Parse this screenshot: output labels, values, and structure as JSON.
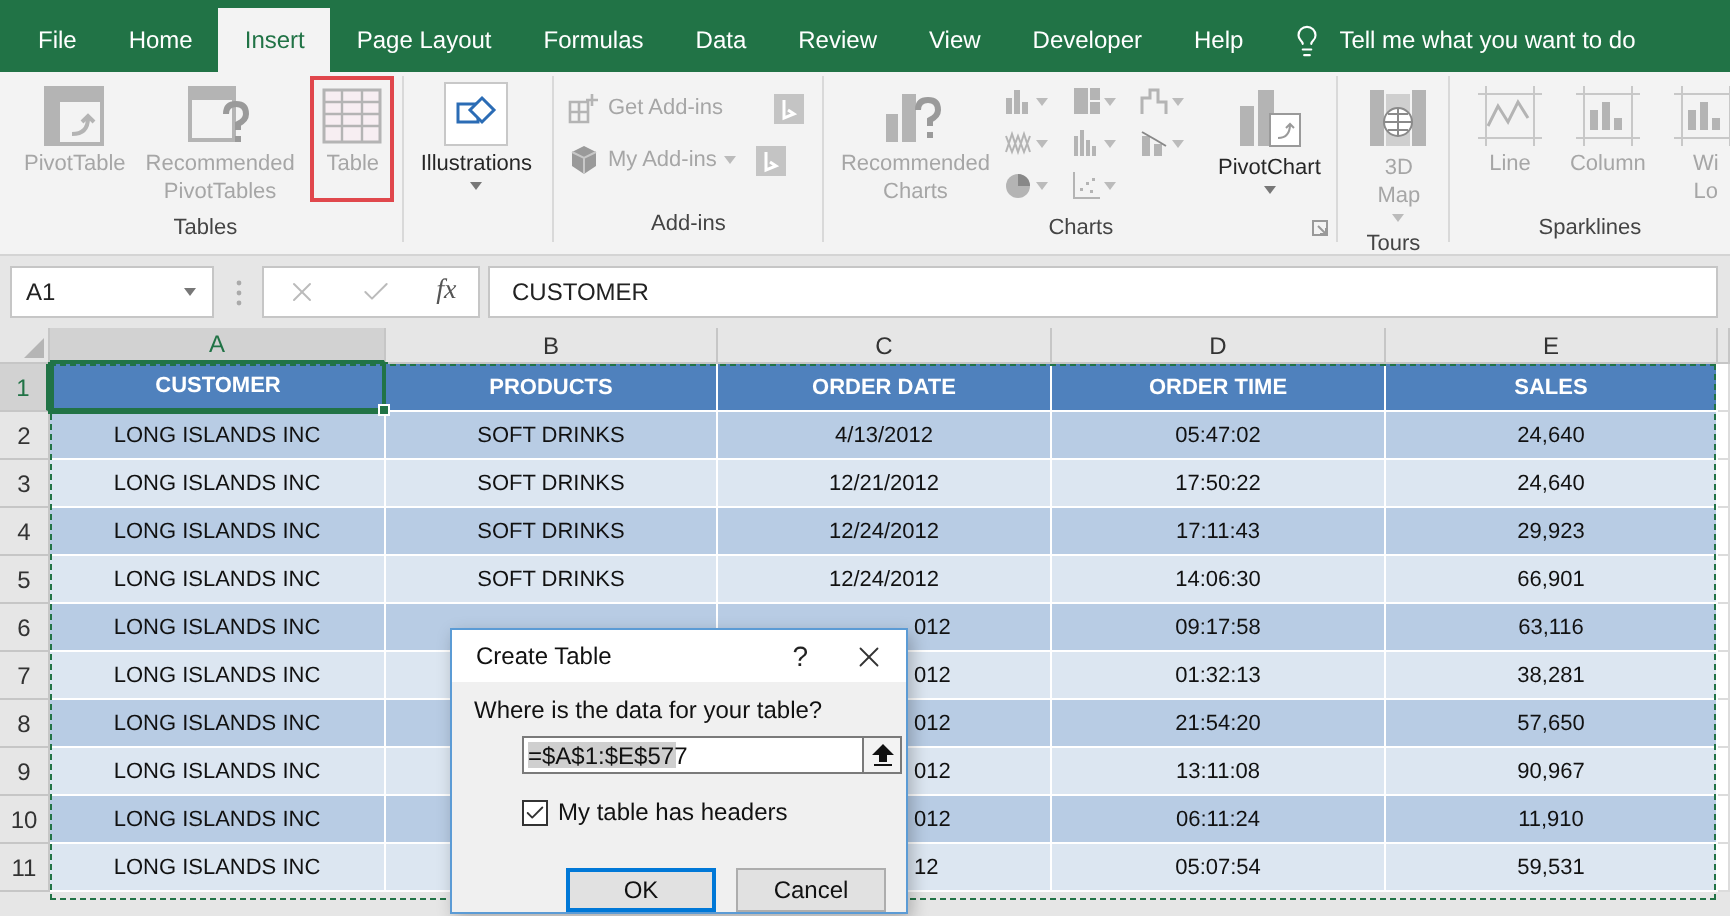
{
  "tabs": [
    {
      "label": "File",
      "selected": false
    },
    {
      "label": "Home",
      "selected": false
    },
    {
      "label": "Insert",
      "selected": true
    },
    {
      "label": "Page Layout",
      "selected": false
    },
    {
      "label": "Formulas",
      "selected": false
    },
    {
      "label": "Data",
      "selected": false
    },
    {
      "label": "Review",
      "selected": false
    },
    {
      "label": "View",
      "selected": false
    },
    {
      "label": "Developer",
      "selected": false
    },
    {
      "label": "Help",
      "selected": false
    }
  ],
  "tell_me": "Tell me what you want to do",
  "ribbon": {
    "tables": {
      "label": "Tables",
      "pivot_table": {
        "label": "PivotTable",
        "disabled": true
      },
      "recommended_pivot_tables": {
        "label": "Recommended PivotTables",
        "disabled": true
      },
      "table": {
        "label": "Table",
        "disabled": true,
        "highlighted": true
      }
    },
    "illustrations": {
      "label": "Illustrations",
      "disabled": false
    },
    "add_ins": {
      "label": "Add-ins",
      "get_add_ins": {
        "label": "Get Add-ins",
        "disabled": true
      },
      "my_add_ins": {
        "label": "My Add-ins",
        "disabled": true
      }
    },
    "charts": {
      "label": "Charts",
      "recommended_charts": {
        "label": "Recommended Charts",
        "disabled": true
      },
      "pivot_chart": {
        "label": "PivotChart",
        "disabled": false
      }
    },
    "tours": {
      "label": "Tours",
      "map_3d": {
        "label": "3D Map",
        "disabled": true
      }
    },
    "sparklines": {
      "label": "Sparklines",
      "items": [
        {
          "label": "Line",
          "disabled": true
        },
        {
          "label": "Column",
          "disabled": true
        },
        {
          "label": "Wi Lo",
          "disabled": true
        }
      ]
    }
  },
  "formula_bar": {
    "name_box": "A1",
    "function_label": "fx",
    "formula": "CUSTOMER"
  },
  "columns": [
    {
      "letter": "A",
      "selected": true
    },
    {
      "letter": "B",
      "selected": false
    },
    {
      "letter": "C",
      "selected": false
    },
    {
      "letter": "D",
      "selected": false
    },
    {
      "letter": "E",
      "selected": false
    }
  ],
  "header_row": {
    "number": "1",
    "selected": true,
    "cells": [
      {
        "text": "CUSTOMER",
        "active": true
      },
      {
        "text": "PRODUCTS",
        "active": false
      },
      {
        "text": "ORDER DATE",
        "active": false
      },
      {
        "text": "ORDER TIME",
        "active": false
      },
      {
        "text": "SALES",
        "active": false
      }
    ]
  },
  "rows": [
    {
      "number": "2",
      "customer": "LONG ISLANDS INC",
      "product": "SOFT DRINKS",
      "order_date": "4/13/2012",
      "order_time": "05:47:02",
      "sales": "24,640"
    },
    {
      "number": "3",
      "customer": "LONG ISLANDS INC",
      "product": "SOFT DRINKS",
      "order_date": "12/21/2012",
      "order_time": "17:50:22",
      "sales": "24,640"
    },
    {
      "number": "4",
      "customer": "LONG ISLANDS INC",
      "product": "SOFT DRINKS",
      "order_date": "12/24/2012",
      "order_time": "17:11:43",
      "sales": "29,923"
    },
    {
      "number": "5",
      "customer": "LONG ISLANDS INC",
      "product": "SOFT DRINKS",
      "order_date": "12/24/2012",
      "order_time": "14:06:30",
      "sales": "66,901"
    },
    {
      "number": "6",
      "customer": "LONG ISLANDS INC",
      "order_date": "012",
      "order_date_clipped": true,
      "order_time": "09:17:58",
      "sales": "63,116"
    },
    {
      "number": "7",
      "customer": "LONG ISLANDS INC",
      "order_date": "012",
      "order_date_clipped": true,
      "order_time": "01:32:13",
      "sales": "38,281"
    },
    {
      "number": "8",
      "customer": "LONG ISLANDS INC",
      "order_date": "012",
      "order_date_clipped": true,
      "order_time": "21:54:20",
      "sales": "57,650"
    },
    {
      "number": "9",
      "customer": "LONG ISLANDS INC",
      "order_date": "012",
      "order_date_clipped": true,
      "order_time": "13:11:08",
      "sales": "90,967"
    },
    {
      "number": "10",
      "customer": "LONG ISLANDS INC",
      "order_date": "012",
      "order_date_clipped": true,
      "order_time": "06:11:24",
      "sales": "11,910"
    },
    {
      "number": "11",
      "customer": "LONG ISLANDS INC",
      "order_date": "12",
      "order_date_clipped": true,
      "order_time": "05:07:54",
      "sales": "59,531"
    }
  ],
  "dialog": {
    "title": "Create Table",
    "help": "?",
    "prompt": "Where is the data for your table?",
    "range": "=$A$1:$E$577",
    "range_selected": true,
    "headers_label": "My table has headers",
    "headers_checked": true,
    "ok": "OK",
    "cancel": "Cancel"
  }
}
